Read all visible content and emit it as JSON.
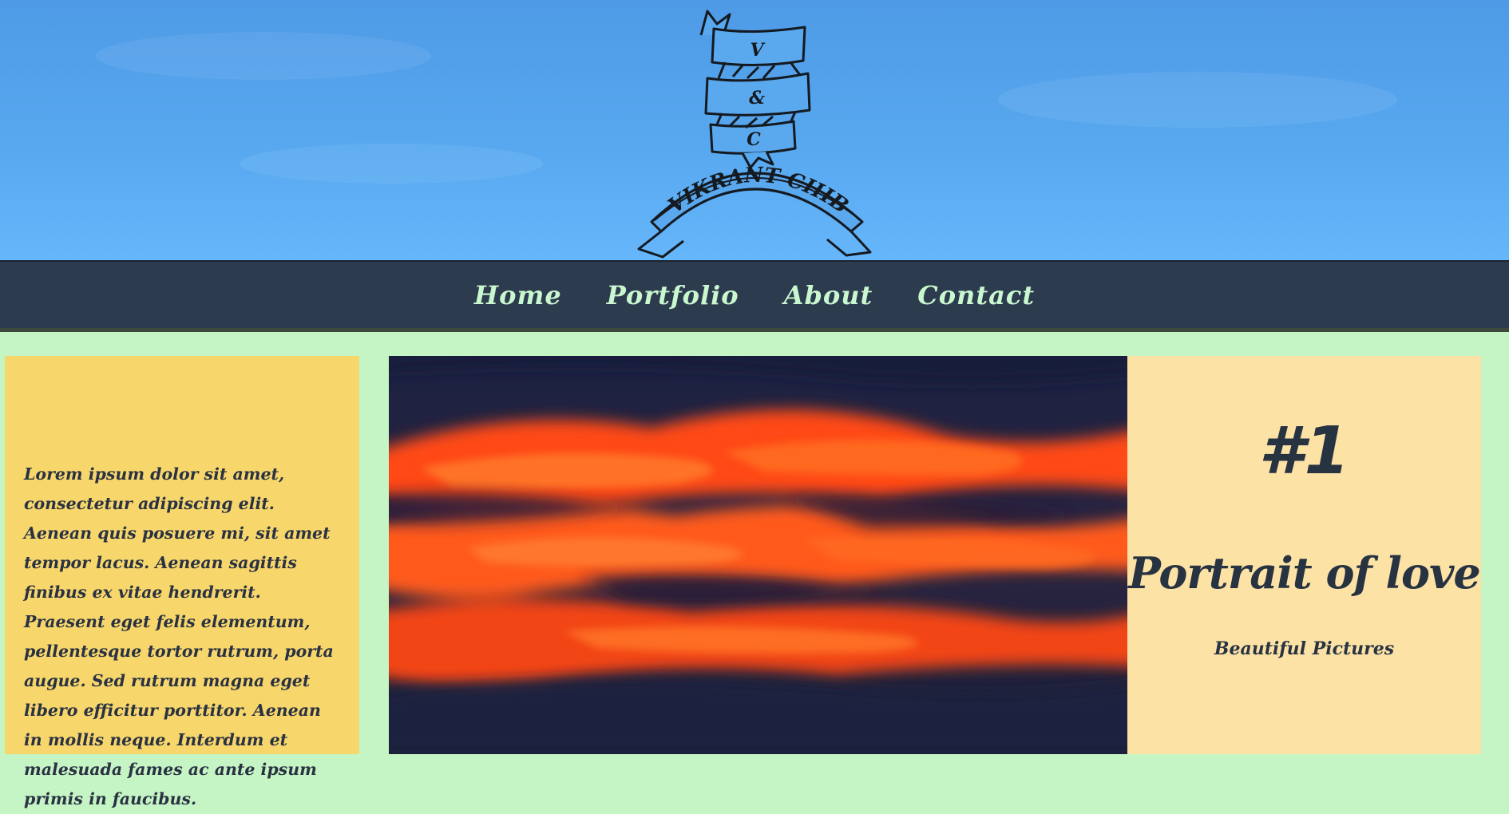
{
  "header": {
    "logo": {
      "top_letter": "V",
      "middle_letter": "&",
      "bottom_letter": "C",
      "banner_text": "VIKRANT CHIB"
    }
  },
  "nav": {
    "items": [
      {
        "label": "Home"
      },
      {
        "label": "Portfolio"
      },
      {
        "label": "About"
      },
      {
        "label": "Contact"
      }
    ]
  },
  "left_panel": {
    "text": "Lorem ipsum dolor sit amet, consectetur adipiscing elit. Aenean quis posuere mi, sit amet tempor lacus. Aenean sagittis finibus ex vitae hendrerit. Praesent eget felis elementum, pellentesque tortor rutrum, porta augue. Sed rutrum magna eget libero efficitur porttitor. Aenean in mollis neque. Interdum et malesuada fames ac ante ipsum primis in faucibus."
  },
  "feature": {
    "image_alt_icon": "sunset-clouds-photo",
    "rank": "#1",
    "title": "Portrait of love",
    "subtitle": "Beautiful Pictures"
  },
  "colors": {
    "sky": "#58a9f0",
    "navbar": "#2d3b4e",
    "nav_text": "#c9f7cf",
    "page_bg": "#c5f5c4",
    "left_panel": "#f7d76b",
    "right_panel": "#fde2a6",
    "dark_text": "#283342"
  }
}
